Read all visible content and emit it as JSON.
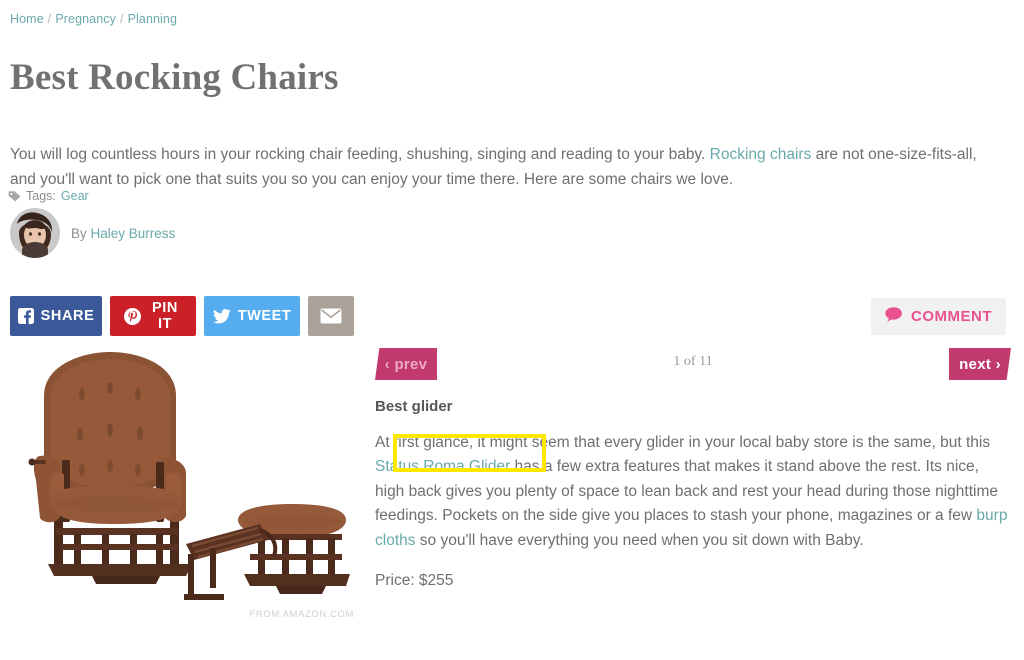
{
  "breadcrumb": {
    "items": [
      "Home",
      "Pregnancy",
      "Planning"
    ],
    "separator": "/"
  },
  "article": {
    "title": "Best Rocking Chairs",
    "dek_part1": "You will log countless hours in your rocking chair feeding, shushing, singing and reading to your baby. ",
    "dek_link": "Rocking chairs",
    "dek_part2": " are not one-size-fits-all, and you'll want to pick one that suits you so you can enjoy your time there. Here are some chairs we love."
  },
  "tags": {
    "icon": "tag-icon",
    "label": "Tags:",
    "value": "Gear"
  },
  "byline": {
    "prefix": "By",
    "author": "Haley Burress",
    "avatar_alt": "author-avatar"
  },
  "share": {
    "facebook": "SHARE",
    "pinterest": "PIN IT",
    "twitter": "TWEET",
    "email_icon": "envelope-icon",
    "comment": "COMMENT"
  },
  "colors": {
    "facebook": "#3b5998",
    "pinterest": "#cb2027",
    "twitter": "#55acee",
    "email": "#aaa199",
    "comment_text": "#e8528f",
    "comment_bg": "#f1f1f1",
    "link_teal": "#6aa9ab",
    "nav_magenta": "#c13a6e",
    "prev_text": "#efa9c4",
    "annotation": "#ffe800"
  },
  "gallery": {
    "prev_label": "prev",
    "next_label": "next",
    "prev_chevron": "‹",
    "next_chevron": "›",
    "counter": "1 of 11",
    "credit": "FROM AMAZON.COM",
    "image_alt": "brown-glider-rocking-chair-with-ottoman"
  },
  "item": {
    "title": "Best glider",
    "body_a": "At first glance, it might seem that every glider in your local baby store is the same, but this ",
    "link_1": "Status Roma Glider",
    "body_b": " has a few extra features that makes it stand above the rest. Its nice, high back gives you plenty of space to lean back and rest your head during those nighttime feedings. Pockets on the side give you places to stash your phone, magazines or a few ",
    "link_2": "burp cloths",
    "body_c": " so you'll have everything you need when you sit down with Baby.",
    "price": "Price: $255"
  }
}
